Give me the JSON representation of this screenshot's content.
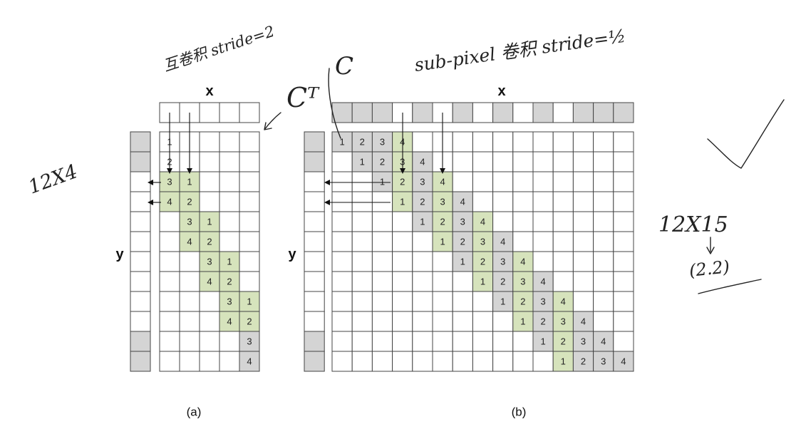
{
  "panel_a": {
    "x_label": "x",
    "y_label": "y",
    "caption": "(a)",
    "x_vector": [
      "",
      "",
      "",
      "",
      ""
    ],
    "y_vector": [
      "grey",
      "grey",
      "white",
      "white",
      "white",
      "white",
      "white",
      "white",
      "white",
      "white",
      "grey",
      "grey"
    ],
    "matrix_entries": [
      {
        "r": 0,
        "c": 0,
        "v": "1",
        "color": "white"
      },
      {
        "r": 1,
        "c": 0,
        "v": "2",
        "color": "white"
      },
      {
        "r": 2,
        "c": 0,
        "v": "3",
        "color": "green"
      },
      {
        "r": 2,
        "c": 1,
        "v": "1",
        "color": "green"
      },
      {
        "r": 3,
        "c": 0,
        "v": "4",
        "color": "green"
      },
      {
        "r": 3,
        "c": 1,
        "v": "2",
        "color": "green"
      },
      {
        "r": 4,
        "c": 1,
        "v": "3",
        "color": "green"
      },
      {
        "r": 4,
        "c": 2,
        "v": "1",
        "color": "green"
      },
      {
        "r": 5,
        "c": 1,
        "v": "4",
        "color": "green"
      },
      {
        "r": 5,
        "c": 2,
        "v": "2",
        "color": "green"
      },
      {
        "r": 6,
        "c": 2,
        "v": "3",
        "color": "green"
      },
      {
        "r": 6,
        "c": 3,
        "v": "1",
        "color": "green"
      },
      {
        "r": 7,
        "c": 2,
        "v": "4",
        "color": "green"
      },
      {
        "r": 7,
        "c": 3,
        "v": "2",
        "color": "green"
      },
      {
        "r": 8,
        "c": 3,
        "v": "3",
        "color": "green"
      },
      {
        "r": 8,
        "c": 4,
        "v": "1",
        "color": "green"
      },
      {
        "r": 9,
        "c": 3,
        "v": "4",
        "color": "green"
      },
      {
        "r": 9,
        "c": 4,
        "v": "2",
        "color": "green"
      },
      {
        "r": 10,
        "c": 4,
        "v": "3",
        "color": "grey"
      },
      {
        "r": 11,
        "c": 4,
        "v": "4",
        "color": "grey"
      }
    ]
  },
  "panel_b": {
    "x_label": "x",
    "y_label": "y",
    "caption": "(b)",
    "x_vector": [
      "grey",
      "grey",
      "grey",
      "white",
      "grey",
      "white",
      "grey",
      "white",
      "grey",
      "white",
      "grey",
      "white",
      "grey",
      "grey",
      "grey"
    ],
    "y_vector": [
      "grey",
      "grey",
      "white",
      "white",
      "white",
      "white",
      "white",
      "white",
      "white",
      "white",
      "grey",
      "grey"
    ],
    "pattern_note": "row r has values 1,2,3,4 at columns r..r+3; green where the column is white in the x vector"
  },
  "annotations": {
    "left_title": "互卷积 stride=2",
    "right_title": "sub-pixel 卷积 stride=½",
    "ct_mark": "Cᵀ",
    "c_mark": "C",
    "size_a": "12X4",
    "size_b": "12X15",
    "size_b_sub": "(2.2)"
  },
  "colors": {
    "grey": "#d4d4d4",
    "green": "#d6e3bc",
    "white": "#ffffff",
    "border": "#444444"
  }
}
